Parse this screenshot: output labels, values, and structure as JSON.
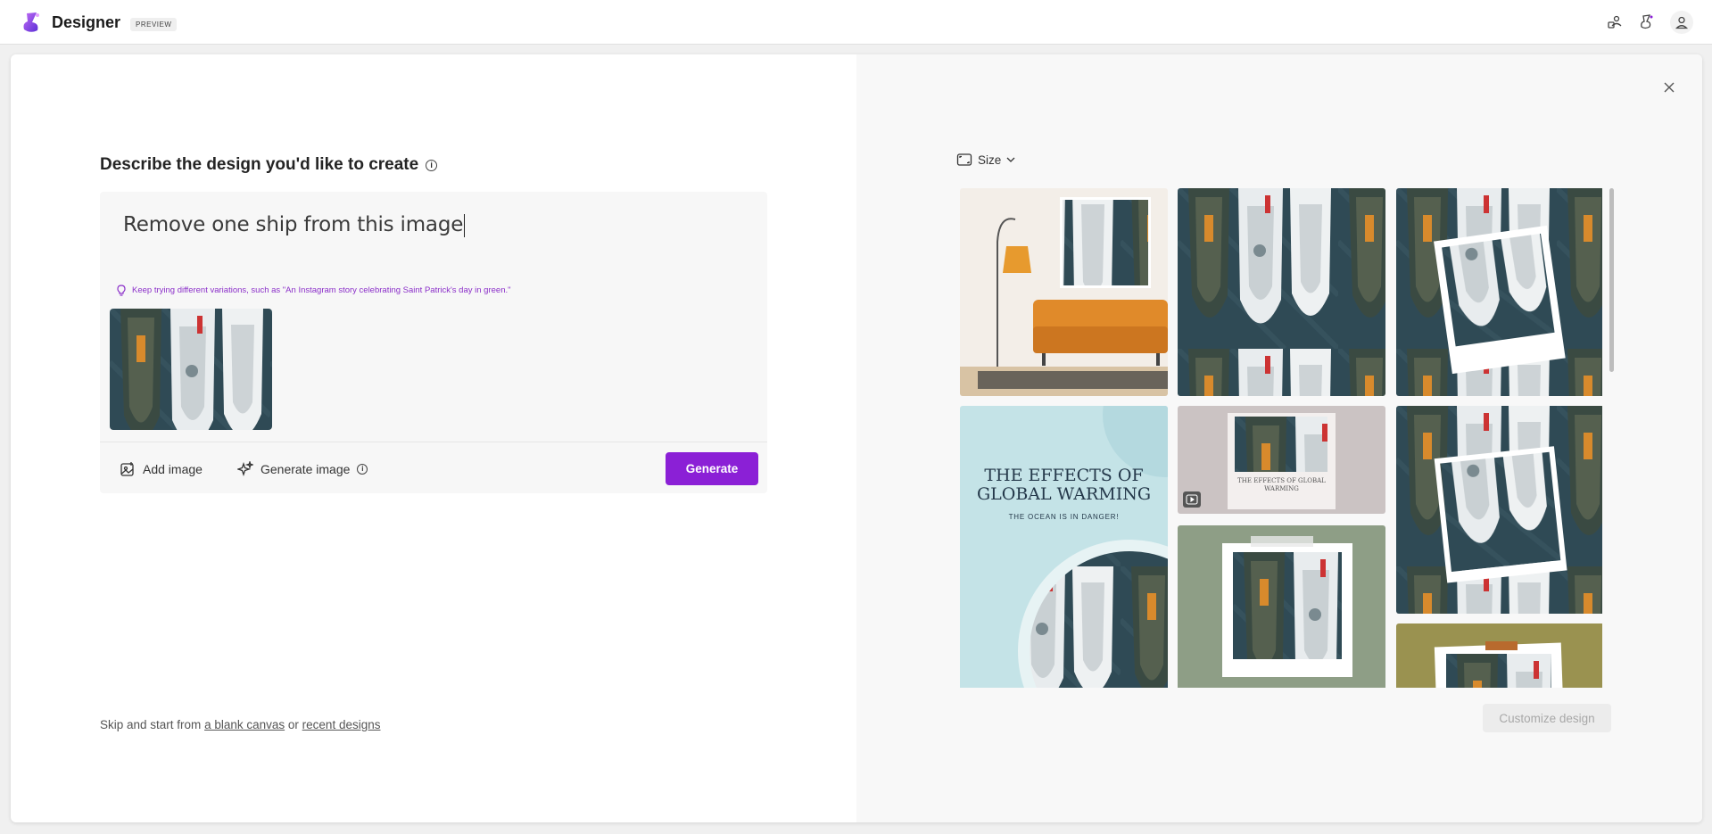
{
  "app": {
    "name": "Designer",
    "badge": "PREVIEW",
    "brand_color": "#8b20d6"
  },
  "header_icons": [
    "share-icon",
    "designer-sparkle-icon",
    "account-icon"
  ],
  "editor": {
    "heading": "Describe the design you'd like to create",
    "prompt_value": "Remove one ship from this image",
    "tip": "Keep trying different variations, such as \"An Instagram story celebrating Saint Patrick's day in green.\"",
    "add_image_label": "Add image",
    "generate_image_label": "Generate image",
    "generate_button": "Generate"
  },
  "footer": {
    "skip_prefix": "Skip and start from",
    "blank_canvas": "a blank canvas",
    "or": "or",
    "recent_designs": "recent designs"
  },
  "results": {
    "size_label": "Size",
    "customize_button": "Customize design",
    "poster_title_line1": "THE EFFECTS OF",
    "poster_title_line2": "GLOBAL WARMING",
    "poster_subtitle": "THE OCEAN IS IN DANGER!",
    "small_poster_line1": "THE EFFECTS OF GLOBAL",
    "small_poster_line2": "WARMING"
  }
}
